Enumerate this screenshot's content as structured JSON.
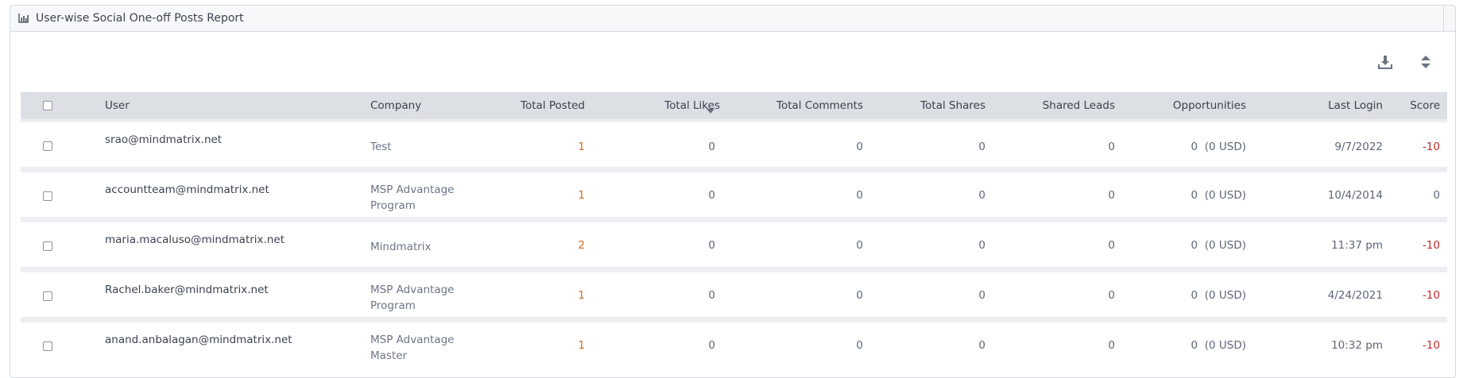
{
  "report": {
    "title": "User-wise Social One-off Posts Report",
    "icon": "bar-chart-icon"
  },
  "toolbar": {
    "download_icon": "download-icon",
    "expand_icon": "sort-expand-icon"
  },
  "columns": {
    "user": "User",
    "company": "Company",
    "total_posted": "Total Posted",
    "total_likes": "Total Likes",
    "total_comments": "Total Comments",
    "total_shares": "Total Shares",
    "shared_leads": "Shared Leads",
    "opportunities": "Opportunities",
    "last_login": "Last Login",
    "score": "Score"
  },
  "sort": {
    "column": "total_likes",
    "direction": "desc"
  },
  "rows": [
    {
      "user": "srao@mindmatrix.net",
      "company_line1": "Test",
      "company_line2": "",
      "total_posted": "1",
      "total_likes": "0",
      "total_comments": "0",
      "total_shares": "0",
      "shared_leads": "0",
      "opportunities": "0",
      "opportunities_usd": "(0 USD)",
      "last_login": "9/7/2022",
      "score": "-10"
    },
    {
      "user": "accountteam@mindmatrix.net",
      "company_line1": "MSP Advantage",
      "company_line2": "Program",
      "total_posted": "1",
      "total_likes": "0",
      "total_comments": "0",
      "total_shares": "0",
      "shared_leads": "0",
      "opportunities": "0",
      "opportunities_usd": "(0 USD)",
      "last_login": "10/4/2014",
      "score": "0"
    },
    {
      "user": "maria.macaluso@mindmatrix.net",
      "company_line1": "Mindmatrix",
      "company_line2": "",
      "total_posted": "2",
      "total_likes": "0",
      "total_comments": "0",
      "total_shares": "0",
      "shared_leads": "0",
      "opportunities": "0",
      "opportunities_usd": "(0 USD)",
      "last_login": "11:37 pm",
      "score": "-10"
    },
    {
      "user": "Rachel.baker@mindmatrix.net",
      "company_line1": "MSP Advantage",
      "company_line2": "Program",
      "total_posted": "1",
      "total_likes": "0",
      "total_comments": "0",
      "total_shares": "0",
      "shared_leads": "0",
      "opportunities": "0",
      "opportunities_usd": "(0 USD)",
      "last_login": "4/24/2021",
      "score": "-10"
    },
    {
      "user": "anand.anbalagan@mindmatrix.net",
      "company_line1": "MSP Advantage",
      "company_line2": "Master",
      "total_posted": "1",
      "total_likes": "0",
      "total_comments": "0",
      "total_shares": "0",
      "shared_leads": "0",
      "opportunities": "0",
      "opportunities_usd": "(0 USD)",
      "last_login": "10:32 pm",
      "score": "-10"
    }
  ],
  "colors": {
    "posted": "#d46a1c",
    "negative_score": "#c62a2a",
    "header_bg": "#dcdfe4"
  }
}
